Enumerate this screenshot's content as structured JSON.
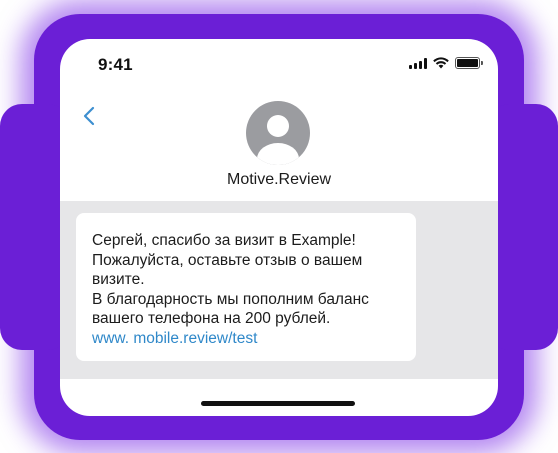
{
  "status_bar": {
    "time": "9:41",
    "icons": [
      "cellular-signal-icon",
      "wifi-icon",
      "battery-icon"
    ]
  },
  "header": {
    "back_icon": "chevron-left-icon",
    "avatar_icon": "person-icon",
    "contact_name": "Motive.Review"
  },
  "message": {
    "lines": [
      "Сергей, спасибо за визит в Example!",
      "Пожалуйста, оставьте отзыв о вашем",
      "визите.",
      "В благодарность мы пополним баланс",
      "вашего телефона на 200 рублей."
    ],
    "link": "www. mobile.review/test"
  },
  "colors": {
    "backdrop_purple": "#6b1fd6",
    "thread_background": "#e6e6e8",
    "link_blue": "#2f88c9",
    "back_chevron_blue": "#3d8fd0",
    "avatar_gray": "#9b9ca0"
  }
}
